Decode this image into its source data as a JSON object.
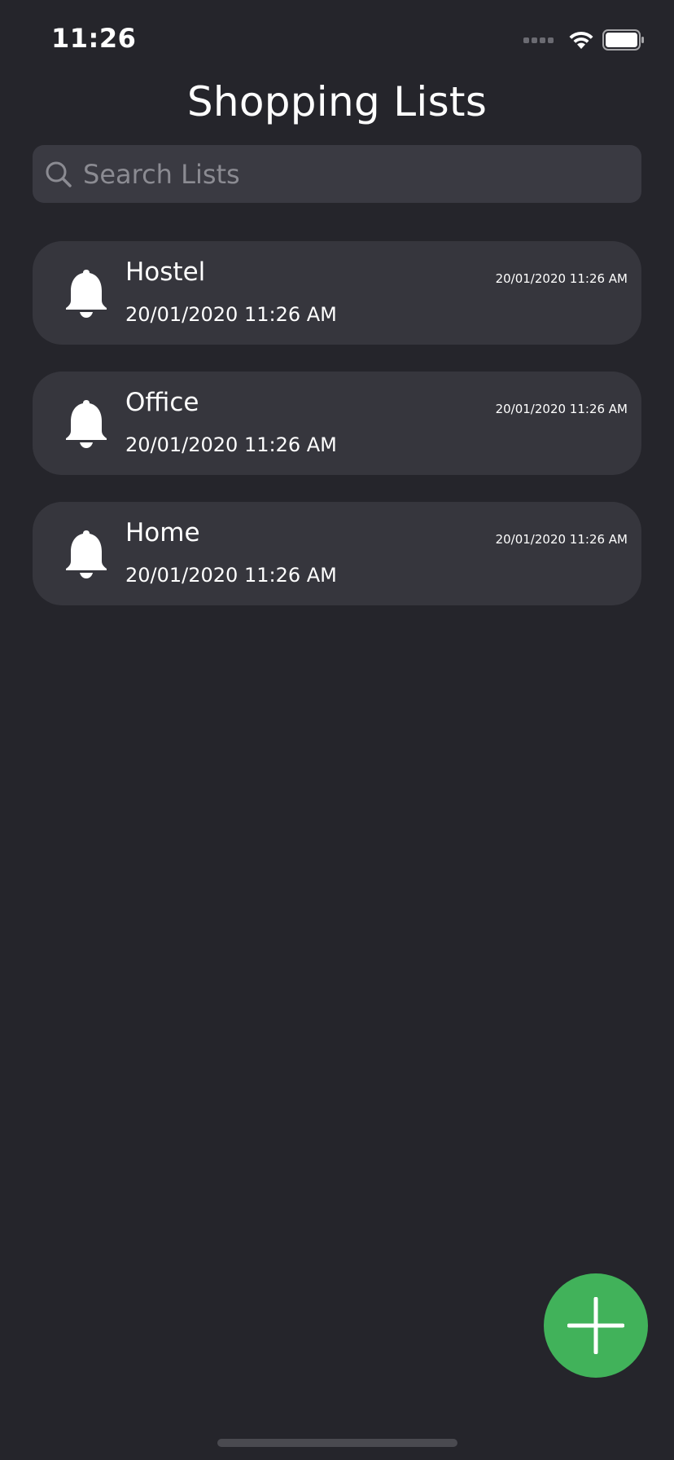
{
  "status_bar": {
    "time": "11:26"
  },
  "header": {
    "title": "Shopping Lists"
  },
  "search": {
    "placeholder": "Search Lists"
  },
  "lists": [
    {
      "name": "Hostel",
      "date": "20/01/2020 11:26 AM",
      "date_small": "20/01/2020 11:26 AM",
      "icon": "bell-icon"
    },
    {
      "name": "Office",
      "date": "20/01/2020 11:26 AM",
      "date_small": "20/01/2020 11:26 AM",
      "icon": "bell-icon"
    },
    {
      "name": "Home",
      "date": "20/01/2020 11:26 AM",
      "date_small": "20/01/2020 11:26 AM",
      "icon": "bell-icon"
    }
  ],
  "fab": {
    "icon": "plus-icon",
    "color": "#41b25a"
  },
  "colors": {
    "background": "#25252b",
    "card": "#36363d",
    "search_bg": "#3a3a42",
    "accent": "#41b25a"
  }
}
